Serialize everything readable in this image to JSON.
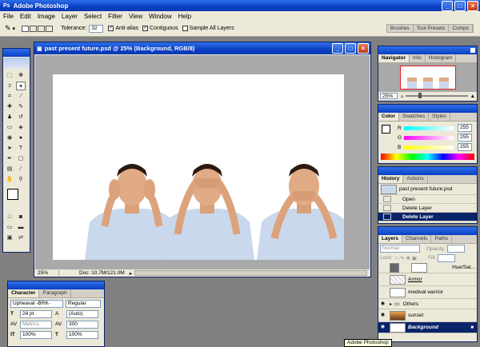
{
  "app": {
    "title": "Adobe Photoshop",
    "tooltip": "Adobe Photoshop"
  },
  "menu": [
    "File",
    "Edit",
    "Image",
    "Layer",
    "Select",
    "Filter",
    "View",
    "Window",
    "Help"
  ],
  "options": {
    "tolerance_label": "Tolerance:",
    "tolerance_value": "32",
    "antialias_label": "Anti-alias",
    "contiguous_label": "Contiguous",
    "sample_label": "Sample All Layers",
    "well_tabs": [
      "Brushes",
      "Tool Presets",
      "Comps"
    ]
  },
  "document": {
    "title": "past present future.psd @ 25% (Background, RGB/8)",
    "zoom": "25%",
    "doc_info": "Doc: 10.7M/121.0M"
  },
  "navigator": {
    "tabs": [
      "Navigator",
      "Info",
      "Histogram"
    ],
    "zoom": "25%"
  },
  "color": {
    "tabs": [
      "Color",
      "Swatches",
      "Styles"
    ],
    "channels": [
      {
        "label": "R",
        "value": "255",
        "color": "#e02020"
      },
      {
        "label": "G",
        "value": "255",
        "color": "#20c020"
      },
      {
        "label": "B",
        "value": "255",
        "color": "#2040e0"
      }
    ]
  },
  "history": {
    "tabs": [
      "History",
      "Actions"
    ],
    "snapshot": "past present future.psd",
    "items": [
      "Open",
      "Delete Layer",
      "Delete Layer"
    ]
  },
  "layers": {
    "tabs": [
      "Layers",
      "Channels",
      "Paths"
    ],
    "blend_mode": "Normal",
    "opacity_label": "Opacity:",
    "lock_label": "Lock:",
    "fill_label": "Fill:",
    "rows": [
      {
        "name": "Hue/Sat..."
      },
      {
        "name": "Armor"
      },
      {
        "name": "medival warrior"
      },
      {
        "name": "Others"
      },
      {
        "name": "sunset"
      },
      {
        "name": "Background"
      }
    ]
  },
  "character": {
    "tabs": [
      "Character",
      "Paragraph"
    ],
    "font_family": "Upheaval -BRK-",
    "font_style": "Regular",
    "size": "24 pt",
    "leading": "(Auto)",
    "kerning": "Metrics",
    "tracking": "300",
    "vscale": "100%",
    "hscale": "100%"
  },
  "colors": {
    "title_blue": "#0a3fc4",
    "chrome": "#ece9d8",
    "canvas_gray": "#a9a9a9"
  }
}
